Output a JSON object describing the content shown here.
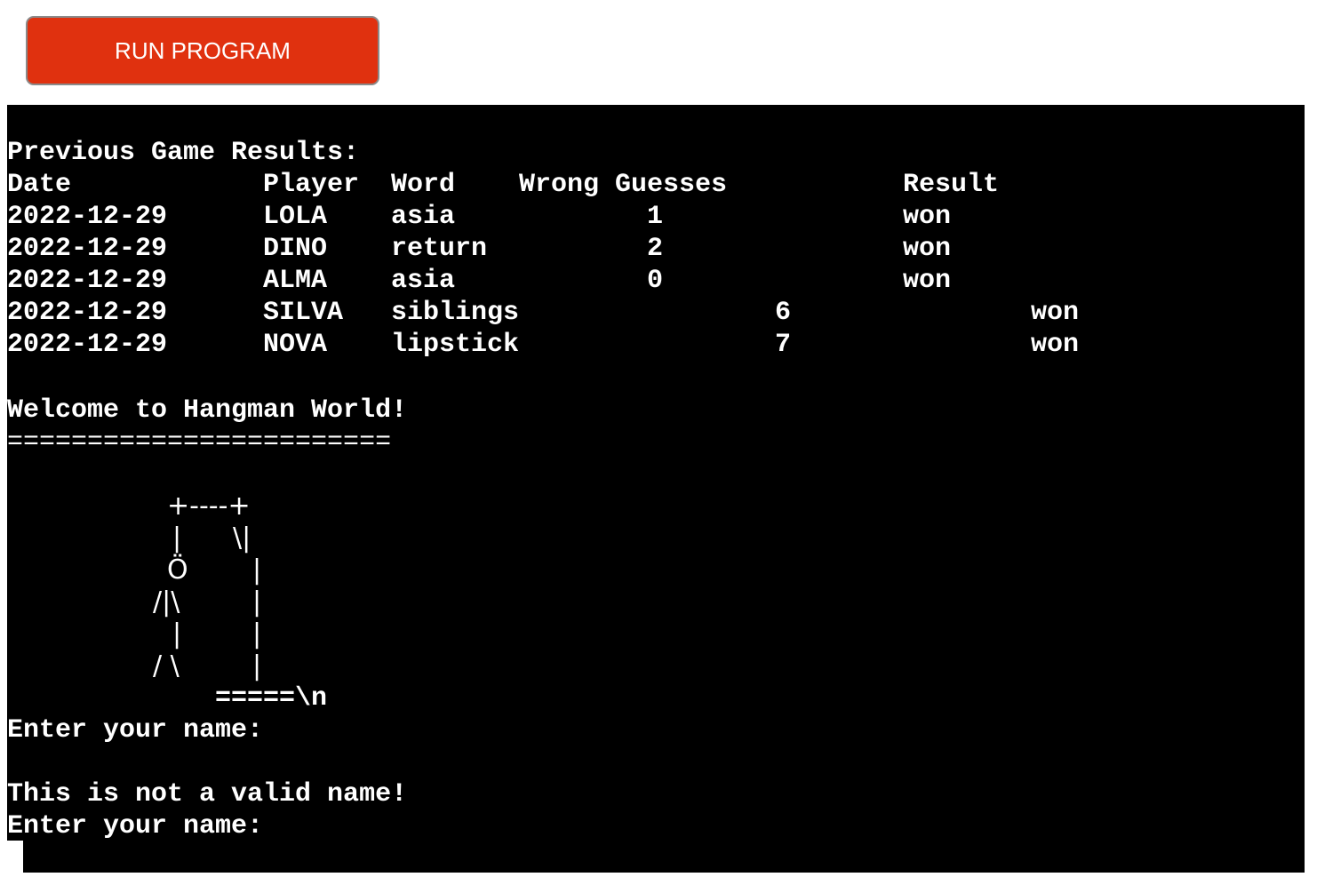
{
  "button": {
    "label": "RUN PROGRAM",
    "color": "#e0310f"
  },
  "terminal": {
    "results_heading": "Previous Game Results:",
    "headers": {
      "date": "Date",
      "player": "Player",
      "word": "Word",
      "wrong": "Wrong Guesses",
      "result": "Result"
    },
    "rows": [
      {
        "date": "2022-12-29",
        "player": "LOLA",
        "word": "asia",
        "wrong": "1",
        "result": "won"
      },
      {
        "date": "2022-12-29",
        "player": "DINO",
        "word": "return",
        "wrong": "2",
        "result": "won"
      },
      {
        "date": "2022-12-29",
        "player": "ALMA",
        "word": "asia",
        "wrong": "0",
        "result": "won"
      },
      {
        "date": "2022-12-29",
        "player": "SILVA",
        "word": "siblings",
        "wrong": "6",
        "result": "won"
      },
      {
        "date": "2022-12-29",
        "player": "NOVA",
        "word": "lipstick",
        "wrong": "7",
        "result": "won"
      }
    ],
    "welcome": "Welcome to Hangman World!",
    "separator": "========================",
    "art": {
      "top": "+----+",
      "line1_left": "|",
      "line1_right": "\\|",
      "head": "Ö",
      "arms": "/|\\",
      "body": "|",
      "legs": "/ \\",
      "pole": "|",
      "base": "=====\\n"
    },
    "prompt1": "Enter your name:",
    "error": "This is not a valid name!",
    "prompt2": "Enter your name:"
  }
}
